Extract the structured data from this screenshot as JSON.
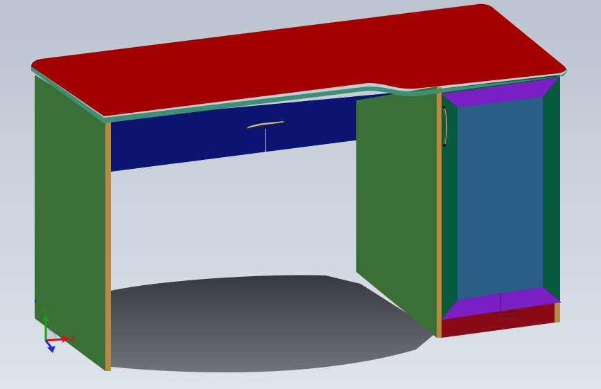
{
  "viewport": {
    "background_top": "#bcc4d0",
    "background_bottom": "#dfe3ea"
  },
  "model": {
    "colors": {
      "desktop_top": "#a30000",
      "desktop_edge": "#3e8f73",
      "left_panel": "#3a6f38",
      "panel_edge": "#b58a44",
      "drawer_front": "#0b1470",
      "cabinet_side": "#3a6f38",
      "cabinet_frame": "#075a3e",
      "door_panel": "#2a5e86",
      "moulding": "#7a1fc4",
      "plinth": "#8a0b18",
      "shadow": "#3b3d42",
      "handle": "#c9b98c"
    }
  },
  "triad": {
    "x_label": "X",
    "y_label": "Y",
    "colors": {
      "x": "#d21414",
      "y": "#17a317",
      "z": "#1a2ccc"
    }
  }
}
